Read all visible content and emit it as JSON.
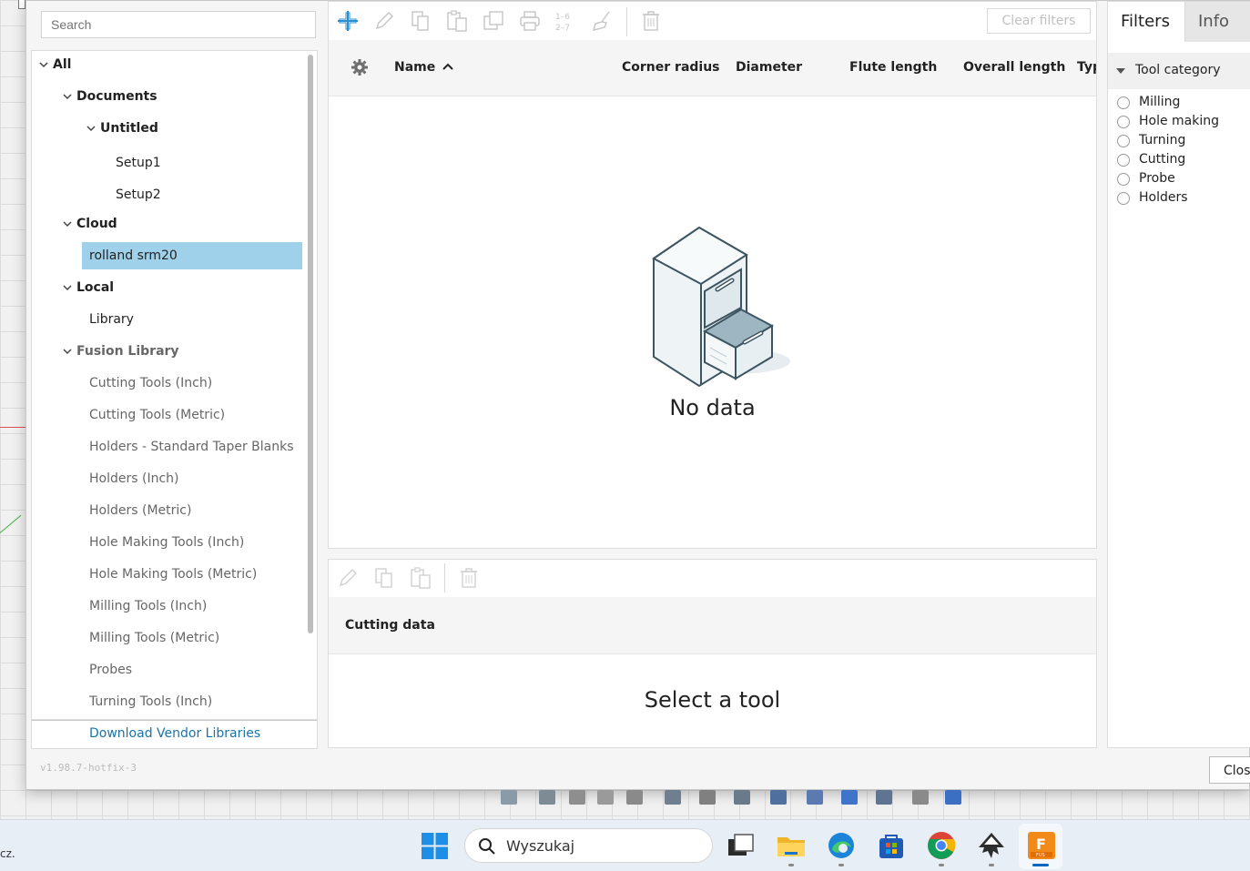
{
  "search": {
    "placeholder": "Search"
  },
  "tree": {
    "items": [
      {
        "label": "All",
        "bold": true
      },
      {
        "label": "Documents",
        "bold": true
      },
      {
        "label": "Untitled",
        "bold": true
      },
      {
        "label": "Setup1"
      },
      {
        "label": "Setup2"
      },
      {
        "label": "Cloud",
        "bold": true
      },
      {
        "label": "rolland srm20",
        "selected": true
      },
      {
        "label": "Local",
        "bold": true
      },
      {
        "label": "Library"
      },
      {
        "label": "Fusion Library",
        "bold": true
      },
      {
        "label": "Cutting Tools (Inch)"
      },
      {
        "label": "Cutting Tools (Metric)"
      },
      {
        "label": "Holders - Standard Taper Blanks"
      },
      {
        "label": "Holders (Inch)"
      },
      {
        "label": "Holders (Metric)"
      },
      {
        "label": "Hole Making Tools (Inch)"
      },
      {
        "label": "Hole Making Tools (Metric)"
      },
      {
        "label": "Milling Tools (Inch)"
      },
      {
        "label": "Milling Tools (Metric)"
      },
      {
        "label": "Probes"
      },
      {
        "label": "Turning Tools (Inch)"
      }
    ],
    "download_label": "Download Vendor Libraries"
  },
  "version": "v1.98.7-hotfix-3",
  "toolbar": {
    "clear_filters": "Clear filters",
    "numbering_icon_text": "1–6 2–7"
  },
  "columns": {
    "name": "Name",
    "corner_radius": "Corner radius",
    "diameter": "Diameter",
    "flute_length": "Flute length",
    "overall_length": "Overall length",
    "type": "Typ"
  },
  "empty_state": "No data",
  "cutting": {
    "title": "Cutting data",
    "empty_state": "Select a tool"
  },
  "filters": {
    "tab_filters": "Filters",
    "tab_info": "Info",
    "category_title": "Tool category",
    "categories": [
      "Milling",
      "Hole making",
      "Turning",
      "Cutting",
      "Probe",
      "Holders"
    ]
  },
  "close_label": "Clos",
  "taskbar": {
    "tray_text": "cz.",
    "search_placeholder": "Wyszukaj"
  },
  "colors": {
    "selection": "#9fd2ea",
    "accent": "#1a73a8",
    "toolbar_add": "#2a8fd0"
  }
}
